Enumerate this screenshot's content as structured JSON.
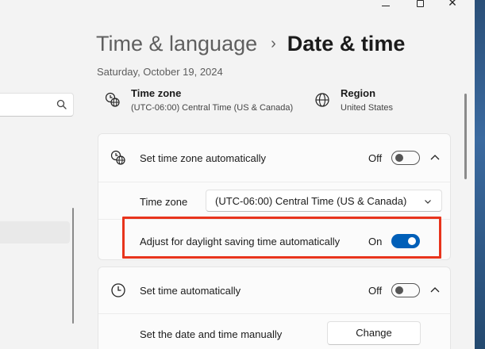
{
  "window": {
    "icons": {
      "minimize": "minimize-icon",
      "maximize": "maximize-icon",
      "close": "close-icon"
    },
    "close_glyph": "✕"
  },
  "nav": {
    "search": {
      "placeholder": "",
      "icon": "search-icon"
    }
  },
  "breadcrumb": {
    "parent": "Time & language",
    "separator": "›",
    "current": "Date & time"
  },
  "date_line": "Saturday, October 19, 2024",
  "info": {
    "time_zone": {
      "title": "Time zone",
      "value": "(UTC-06:00) Central Time (US & Canada)",
      "icon": "globe-clock-icon"
    },
    "region": {
      "title": "Region",
      "value": "United States",
      "icon": "globe-icon"
    }
  },
  "settings": {
    "tz_auto": {
      "label": "Set time zone automatically",
      "state": "Off",
      "toggle_on": false,
      "icon": "globe-clock-icon",
      "expanded": true
    },
    "tz_select": {
      "label": "Time zone",
      "selected": "(UTC-06:00) Central Time (US & Canada)"
    },
    "dst": {
      "label": "Adjust for daylight saving time automatically",
      "state": "On",
      "toggle_on": true
    },
    "time_auto": {
      "label": "Set time automatically",
      "state": "Off",
      "toggle_on": false,
      "icon": "clock-icon",
      "expanded": true
    },
    "manual": {
      "label": "Set the date and time manually",
      "button": "Change"
    }
  },
  "colors": {
    "accent": "#005fb8",
    "highlight_box": "#e8341c",
    "background": "#f3f3f3",
    "card": "#fbfbfb"
  }
}
